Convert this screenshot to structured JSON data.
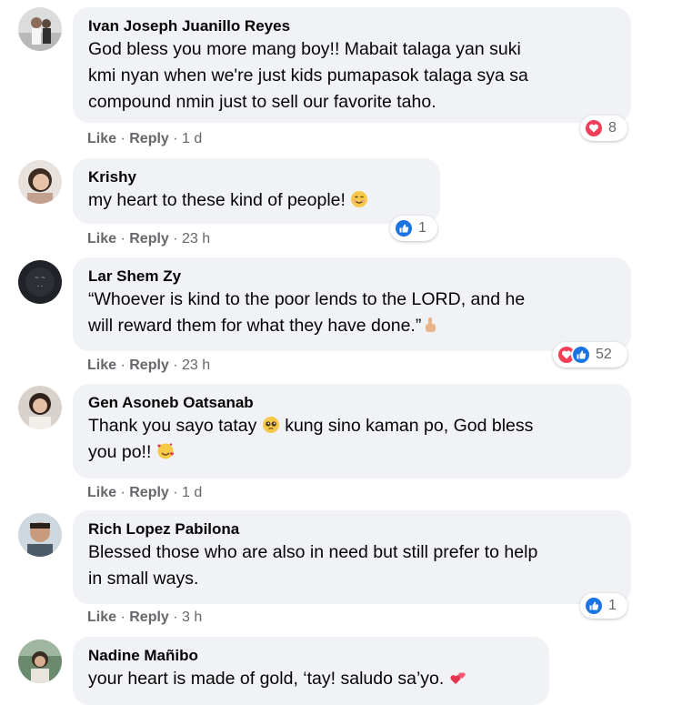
{
  "comments": [
    {
      "name": "Ivan Joseph Juanillo Reyes",
      "text": "God bless you more mang boy!! Mabait talaga yan suki\nkmi nyan when we're just kids pumapasok talaga sya sa\ncompound nmin just to sell our favorite taho.",
      "like": "Like",
      "reply": "Reply",
      "time": "1 d",
      "reaction_count": "8"
    },
    {
      "name": "Krishy",
      "text": "my heart to these kind of people!",
      "like": "Like",
      "reply": "Reply",
      "time": "23 h",
      "reaction_count": "1"
    },
    {
      "name": "Lar Shem Zy",
      "text": "“Whoever is kind to the poor lends to the LORD, and he\nwill reward them for what they have done.”",
      "like": "Like",
      "reply": "Reply",
      "time": "23 h",
      "reaction_count": "52"
    },
    {
      "name": "Gen Asoneb Oatsanab",
      "text_a": "Thank you sayo tatay",
      "text_b": "kung sino kaman po, God bless",
      "text_c": "you po!!",
      "like": "Like",
      "reply": "Reply",
      "time": "1 d"
    },
    {
      "name": "Rich Lopez Pabilona",
      "text": "Blessed those who are also in need but still prefer to help\nin small ways.",
      "like": "Like",
      "reply": "Reply",
      "time": "3 h",
      "reaction_count": "1"
    },
    {
      "name": "Nadine Mañibo",
      "text": "your heart is made of gold, ‘tay! saludo sa’yo."
    }
  ],
  "colors": {
    "bubble": "#f0f2f5",
    "meta": "#65676b",
    "like_blue": "#1b74e4",
    "love_red": "#f33e58"
  }
}
